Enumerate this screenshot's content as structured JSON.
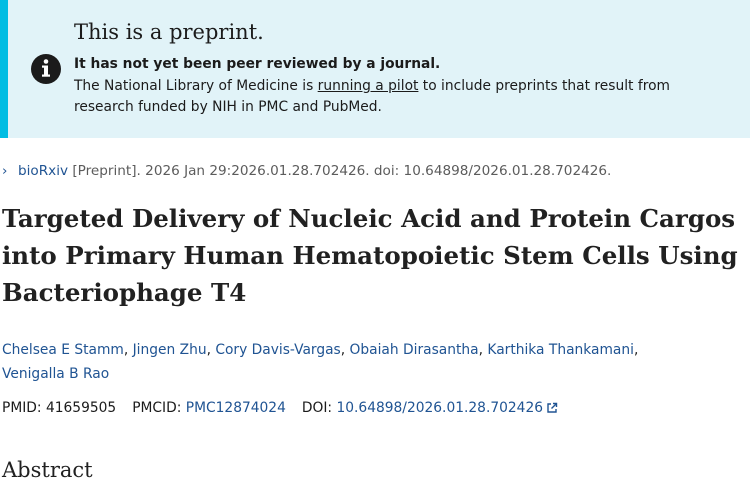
{
  "banner": {
    "heading": "This is a preprint.",
    "bold_line": "It has not yet been peer reviewed by a journal.",
    "text_before": "The National Library of Medicine is ",
    "link_text": "running a pilot",
    "text_after": " to include preprints that result from research funded by NIH in PMC and PubMed.",
    "icon": "info-icon",
    "background_color": "#e1f3f8",
    "border_color": "#00bde3"
  },
  "citation": {
    "chevron": "›",
    "journal": "bioRxiv",
    "details": " [Preprint]. 2026 Jan 29:2026.01.28.702426. doi: 10.64898/2026.01.28.702426."
  },
  "article": {
    "title": "Targeted Delivery of Nucleic Acid and Protein Cargos into Primary Human Hematopoietic Stem Cells Using Bacteriophage T4",
    "authors": [
      "Chelsea E Stamm",
      "Jingen Zhu",
      "Cory Davis-Vargas",
      "Obaiah Dirasantha",
      "Karthika Thankamani",
      "Venigalla B Rao"
    ],
    "author_separator": ", "
  },
  "identifiers": {
    "pmid_label": "PMID: ",
    "pmid": "41659505",
    "pmcid_label": "PMCID: ",
    "pmcid": "PMC12874024",
    "doi_label": "DOI: ",
    "doi": "10.64898/2026.01.28.702426",
    "doi_icon": "external-link-icon"
  },
  "sections": {
    "abstract_heading": "Abstract"
  },
  "colors": {
    "link": "#205493",
    "text": "#1b1b1b"
  }
}
